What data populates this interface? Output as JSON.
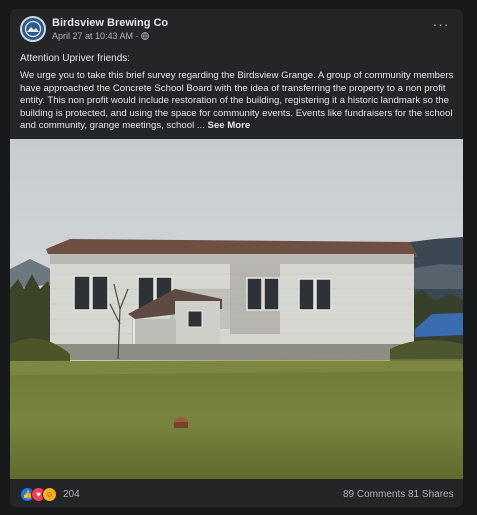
{
  "post": {
    "author": "Birdsview Brewing Co",
    "date": "April 27 at 10:43 AM",
    "separator": "·",
    "greeting": "Attention Upriver friends:",
    "body": "We urge you to take this brief survey regarding the Birdsview Grange. A group of community members have approached the Concrete School Board with the idea of transferring the property to a non profit entity. This non profit would include restoration of the building, registering it a historic landmark so the building is protected, and using the space for community events. Events like fundraisers for the school and community, grange meetings, school ...",
    "see_more": "See More",
    "more_options": "···"
  },
  "footer": {
    "reaction_count": "204",
    "comments": "89 Comments",
    "shares": "81 Shares"
  },
  "icons": {
    "reactions": [
      "like-icon",
      "love-icon",
      "care-icon"
    ],
    "privacy": "globe-icon"
  },
  "colors": {
    "card": "#242526",
    "text": "#e4e6eb",
    "secondary_text": "#b0b3b8",
    "like": "#1877f2",
    "love": "#f33e58",
    "care": "#f7b125"
  }
}
